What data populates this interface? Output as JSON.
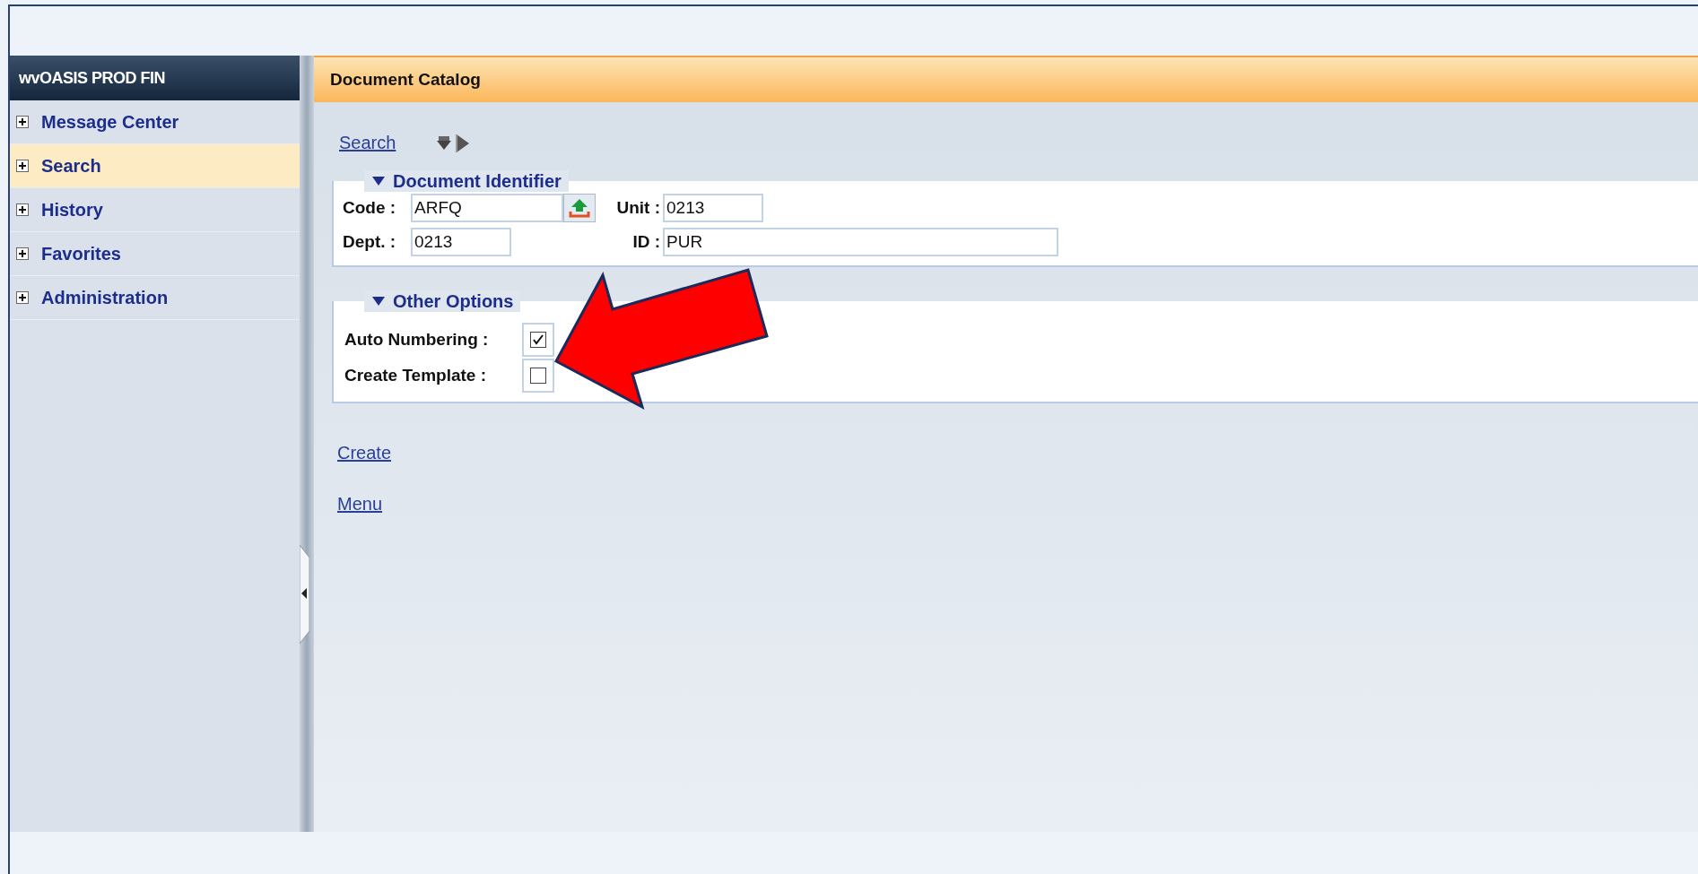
{
  "sidebar": {
    "title": "wvOASIS PROD FIN",
    "items": [
      {
        "label": "Message Center",
        "selected": false,
        "expanded": false
      },
      {
        "label": "Search",
        "selected": true,
        "expanded": false
      },
      {
        "label": "History",
        "selected": false,
        "expanded": false
      },
      {
        "label": "Favorites",
        "selected": false,
        "expanded": false
      },
      {
        "label": "Administration",
        "selected": false,
        "expanded": false
      }
    ]
  },
  "main": {
    "title": "Document Catalog",
    "toolbar": {
      "link": "Search"
    },
    "document_identifier": {
      "legend": "Document Identifier",
      "expanded": true,
      "code": {
        "label": "Code :",
        "value": "ARFQ"
      },
      "unit": {
        "label": "Unit :",
        "value": "0213"
      },
      "dept": {
        "label": "Dept. :",
        "value": "0213"
      },
      "id": {
        "label": "ID :",
        "value": "PUR"
      }
    },
    "other_options": {
      "legend": "Other Options",
      "expanded": true,
      "options": [
        {
          "label": "Auto Numbering :",
          "checked": true
        },
        {
          "label": "Create Template :",
          "checked": false
        }
      ]
    },
    "links": [
      "Create",
      "Menu"
    ]
  }
}
